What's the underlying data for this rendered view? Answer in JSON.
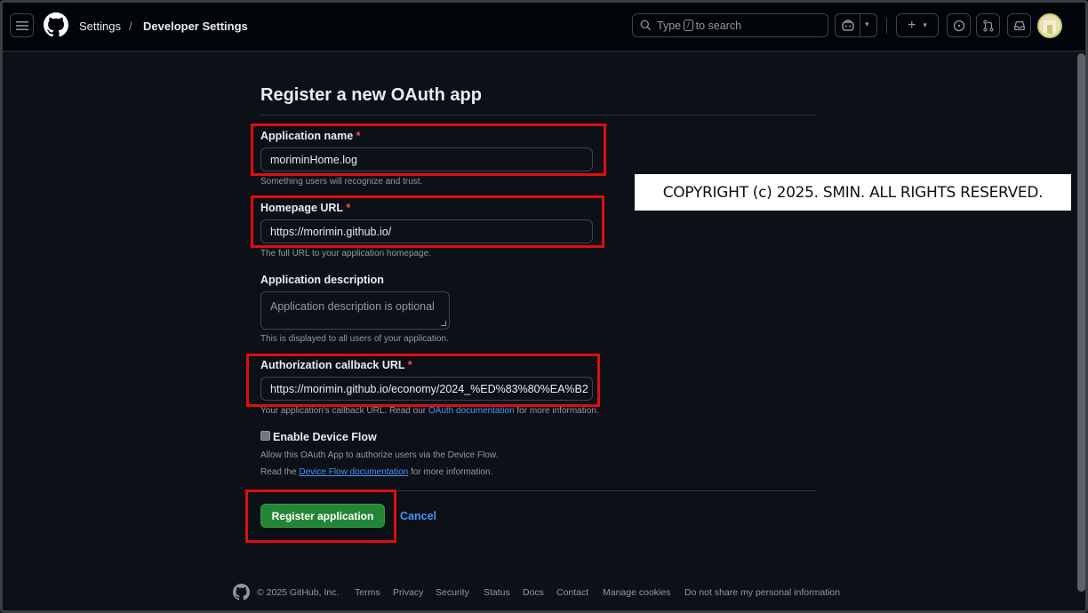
{
  "header": {
    "breadcrumb": [
      "Settings",
      "Developer Settings"
    ],
    "breadcrumb_separator": "/",
    "search_placeholder_pre": "Type",
    "search_key": "/",
    "search_placeholder_post": "to search",
    "plus_label": "+",
    "dropdown_glyph": "▾"
  },
  "form": {
    "title": "Register a new OAuth app",
    "required_mark": "*",
    "app_name": {
      "label": "Application name",
      "value": "moriminHome.log",
      "note": "Something users will recognize and trust."
    },
    "homepage": {
      "label": "Homepage URL",
      "value": "https://morimin.github.io/",
      "note": "The full URL to your application homepage."
    },
    "description": {
      "label": "Application description",
      "placeholder": "Application description is optional",
      "note": "This is displayed to all users of your application."
    },
    "callback": {
      "label": "Authorization callback URL",
      "value": "https://morimin.github.io/economy/2024_%ED%83%80%EA%B2",
      "note_pre": "Your application's callback URL. Read our ",
      "note_link": "OAuth documentation",
      "note_post": " for more information."
    },
    "device_flow": {
      "label": "Enable Device Flow",
      "checked": false,
      "note1": "Allow this OAuth App to authorize users via the Device Flow.",
      "note2_pre": "Read the ",
      "note2_link": "Device Flow documentation",
      "note2_post": " for more information."
    },
    "register_button": "Register application",
    "cancel_link": "Cancel"
  },
  "overlay": {
    "copyright": "COPYRIGHT (c) 2025. SMIN. ALL RIGHTS RESERVED."
  },
  "footer": {
    "copyright": "© 2025 GitHub, Inc.",
    "links": [
      "Terms",
      "Privacy",
      "Security",
      "Status",
      "Docs",
      "Contact",
      "Manage cookies",
      "Do not share my personal information"
    ]
  },
  "colors": {
    "background": "#0d1117",
    "header": "#010409",
    "primary_button": "#238636",
    "link": "#4493f8",
    "required": "#f85149",
    "highlight": "#e00d0d"
  }
}
